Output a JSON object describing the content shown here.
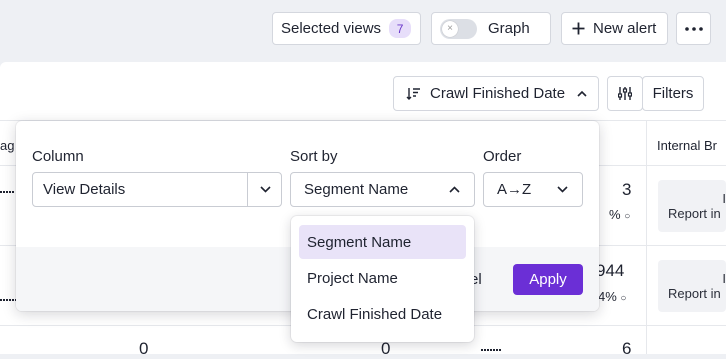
{
  "toolbar": {
    "selected_views_label": "Selected views",
    "selected_views_count": "7",
    "graph_label": "Graph",
    "new_alert_label": "New alert",
    "more_icon": "more-horizontal-icon"
  },
  "panel": {
    "sort_button_label": "Crawl Finished Date",
    "filters_label": "Filters"
  },
  "table": {
    "header_partial_left": "ag",
    "header_internal": "Internal Br",
    "row1": {
      "value": "3",
      "percent": "%",
      "chip_line1": "I",
      "chip_line2": "Report in"
    },
    "row2": {
      "value": "944",
      "percent": "4%",
      "chip_line1": "I",
      "chip_line2": "Report in"
    },
    "row3": {
      "value_a": "0",
      "value_b": "0",
      "value_c": "6"
    }
  },
  "sort_popup": {
    "column_label": "Column",
    "column_value": "View Details",
    "sort_by_label": "Sort by",
    "sort_by_value": "Segment Name",
    "order_label": "Order",
    "order_value": "A→Z",
    "cancel_partial": "el",
    "apply_label": "Apply",
    "options": [
      "Segment Name",
      "Project Name",
      "Crawl Finished Date"
    ],
    "selected_option": "Segment Name"
  },
  "colors": {
    "accent": "#6b2fd6",
    "badge_bg": "#e7defa",
    "selected_option_bg": "#e9e3f8"
  }
}
